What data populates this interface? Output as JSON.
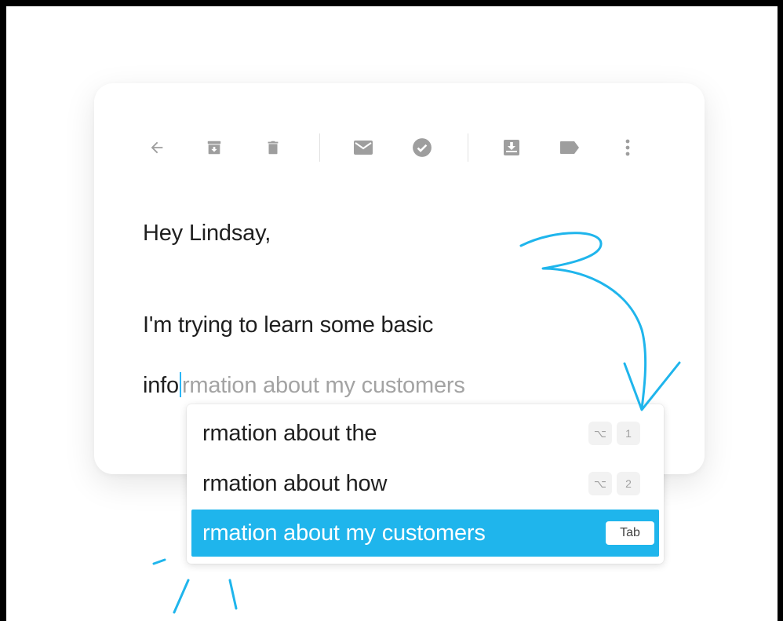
{
  "toolbar": {
    "icons": [
      "back-arrow-icon",
      "archive-icon",
      "trash-icon",
      "mail-icon",
      "check-circle-icon",
      "move-to-inbox-icon",
      "label-icon",
      "more-vert-icon"
    ],
    "icon_color": "#9e9e9e"
  },
  "message": {
    "line1": "Hey Lindsay,",
    "line2": "I'm trying to learn some basic",
    "typed": "info",
    "ghost": "rmation about my customers"
  },
  "suggestions": [
    {
      "label": "rmation about the",
      "modifier": "⌥",
      "key": "1",
      "active": false
    },
    {
      "label": "rmation about how",
      "modifier": "⌥",
      "key": "2",
      "active": false
    },
    {
      "label": "rmation about my customers",
      "key": "Tab",
      "active": true
    }
  ],
  "colors": {
    "accent": "#1fb5ec",
    "doodle": "#1fb5ec"
  }
}
